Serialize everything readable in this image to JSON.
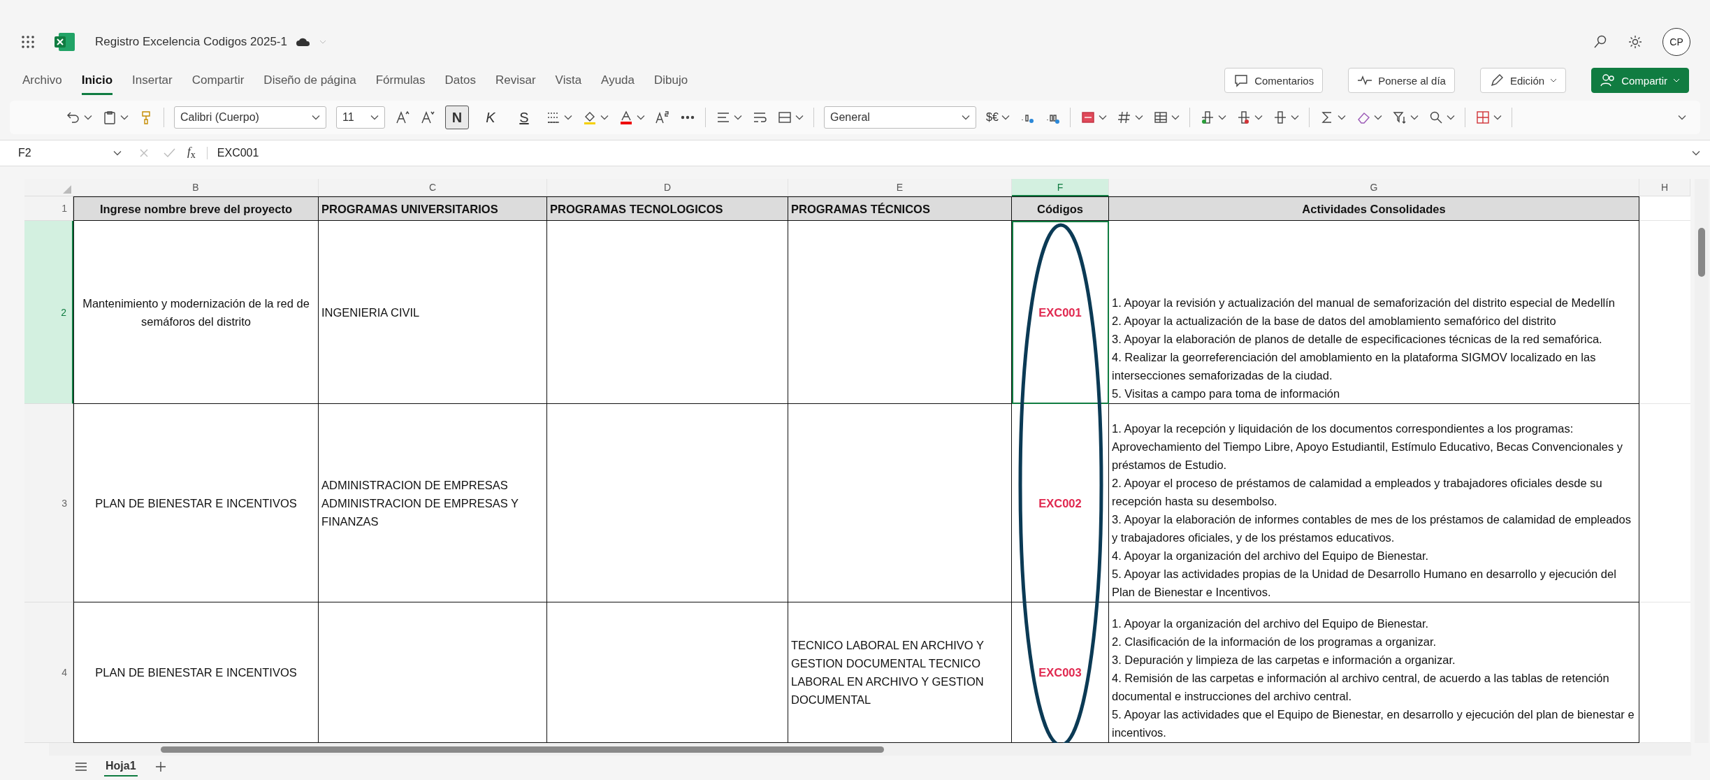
{
  "app": {
    "title": "Registro Excelencia Codigos 2025-1",
    "avatar": "CP"
  },
  "menu_tabs": [
    {
      "label": "Archivo",
      "selected": false
    },
    {
      "label": "Inicio",
      "selected": true
    },
    {
      "label": "Insertar",
      "selected": false
    },
    {
      "label": "Compartir",
      "selected": false
    },
    {
      "label": "Diseño de página",
      "selected": false
    },
    {
      "label": "Fórmulas",
      "selected": false
    },
    {
      "label": "Datos",
      "selected": false
    },
    {
      "label": "Revisar",
      "selected": false
    },
    {
      "label": "Vista",
      "selected": false
    },
    {
      "label": "Ayuda",
      "selected": false
    },
    {
      "label": "Dibujo",
      "selected": false
    }
  ],
  "actions": [
    {
      "kind": "comments",
      "label": "Comentarios"
    },
    {
      "kind": "catch_up",
      "label": "Ponerse al día"
    },
    {
      "kind": "editing",
      "label": "Edición"
    },
    {
      "kind": "share",
      "label": "Compartir"
    }
  ],
  "toolbar": {
    "font": "Calibri (Cuerpo)",
    "size": "11",
    "bold": {
      "label": "N",
      "selected": true
    },
    "italic": {
      "label": "K",
      "selected": false
    },
    "underline": {
      "label": "S",
      "selected": false
    },
    "number_format": "General",
    "currency": "$€"
  },
  "formula_bar": {
    "cell": "F2",
    "function_label": "*f*$_{x}$",
    "value": "EXC001"
  },
  "grid": {
    "columns": [
      {
        "letter": "B",
        "selected": false
      },
      {
        "letter": "C",
        "selected": false
      },
      {
        "letter": "D",
        "selected": false
      },
      {
        "letter": "E",
        "selected": false
      },
      {
        "letter": "F",
        "selected": true
      },
      {
        "letter": "G",
        "selected": false
      },
      {
        "letter": "H",
        "selected": false
      }
    ],
    "header_row": {
      "number": "1",
      "cells": [
        "Ingrese nombre breve del proyecto",
        "PROGRAMAS UNIVERSITARIOS",
        "PROGRAMAS TECNOLOGICOS",
        "PROGRAMAS TÉCNICOS",
        "Códigos",
        "Actividades Consolidades"
      ]
    },
    "rows": [
      {
        "number": "2",
        "selected": true,
        "project": "Mantenimiento y modernización de la red de semáforos del distrito",
        "universitarios": "INGENIERIA CIVIL",
        "code": "EXC001",
        "code_selected": true,
        "activities": [
          "1. Apoyar la revisión y actualización del manual de semaforización del distrito especial de Medellín",
          "2. Apoyar la actualización de la base de datos del amoblamiento semafórico del distrito",
          "3. Apoyar la elaboración de planos de detalle de especificaciones técnicas de la red semafórica.",
          "4. Realizar la georreferenciación del amoblamiento en la plataforma SIGMOV localizado en las intersecciones semaforizadas de la ciudad.",
          "5. Visitas a campo para toma de información"
        ]
      },
      {
        "number": "3",
        "selected": false,
        "project": "PLAN DE BIENESTAR E INCENTIVOS",
        "universitarios": "ADMINISTRACION DE EMPRESAS ADMINISTRACION DE EMPRESAS Y FINANZAS",
        "code": "EXC002",
        "code_selected": false,
        "activities": [
          "1. Apoyar la recepción y liquidación de los documentos correspondientes a los programas: Aprovechamiento del Tiempo Libre, Apoyo Estudiantil, Estímulo Educativo, Becas Convencionales y préstamos de Estudio.",
          "2. Apoyar el proceso de préstamos de calamidad a empleados y trabajadores oficiales desde su recepción hasta su desembolso.",
          "3. Apoyar la elaboración de informes contables de mes de los préstamos de calamidad de empleados y trabajadores oficiales, y de los préstamos educativos.",
          "4. Apoyar la organización del archivo del Equipo de Bienestar.",
          "5. Apoyar las actividades propias de la Unidad de Desarrollo Humano en desarrollo y ejecución del Plan de Bienestar e Incentivos."
        ]
      },
      {
        "number": "4",
        "selected": false,
        "project": "PLAN DE BIENESTAR E INCENTIVOS",
        "tecnicos": "TECNICO LABORAL EN ARCHIVO Y GESTION DOCUMENTAL TECNICO LABORAL EN ARCHIVO Y GESTION DOCUMENTAL",
        "code": "EXC003",
        "code_selected": false,
        "activities": [
          "1. Apoyar la organización del archivo del Equipo de Bienestar.",
          "2. Clasificación de la información de los programas a organizar.",
          "3. Depuración y limpieza de las carpetas e información a organizar.",
          "4. Remisión de las carpetas e información al archivo central, de acuerdo a las tablas de retención documental e instrucciones del archivo central.",
          "5. Apoyar las actividades que el Equipo de Bienestar, en desarrollo y ejecución del plan de bienestar e incentivos."
        ]
      }
    ]
  },
  "sheet_tabs": [
    {
      "label": "Hoja1",
      "selected": true
    }
  ]
}
